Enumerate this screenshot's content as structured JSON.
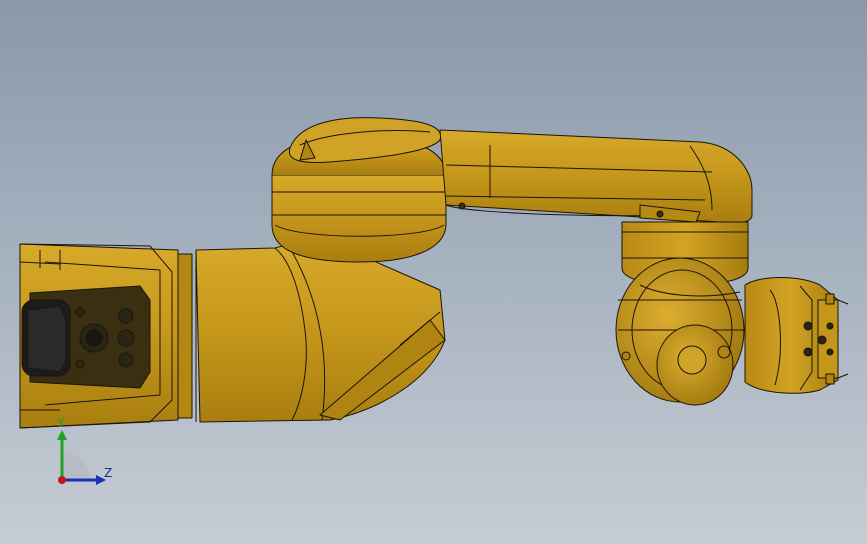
{
  "viewport": {
    "model_color": "#c89a18",
    "edge_color": "#1a1508",
    "background_top": "#8a98aa",
    "background_bottom": "#c6ccd4"
  },
  "triad": {
    "y_label": "Y",
    "z_label": "Z",
    "y_color": "#1fa12a",
    "z_color": "#1f2fb4",
    "x_color": "#c01818"
  }
}
